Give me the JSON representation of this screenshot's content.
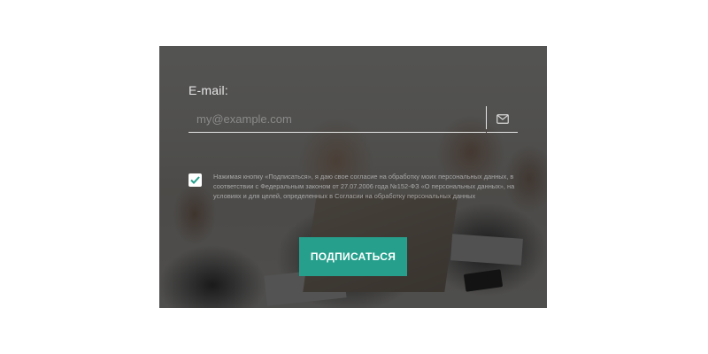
{
  "form": {
    "email_label": "E-mail:",
    "email_placeholder": "my@example.com",
    "email_value": "",
    "mail_icon": "envelope-icon",
    "consent_checked": true,
    "consent_text": "Нажимая кнопку «Подписаться», я даю свое согласие на обработку моих персональных данных, в соответствии с Федеральным законом от 27.07.2006 года №152-ФЗ «О персональных данных», на условиях и для целей, определенных в Согласии на обработку персональных данных",
    "submit_label": "ПОДПИСАТЬСЯ"
  },
  "colors": {
    "accent": "#26a08d",
    "checkmark": "#26a08d",
    "overlay": "#141414",
    "text_light": "#e6e6e6",
    "text_muted": "#a9a9a9"
  }
}
